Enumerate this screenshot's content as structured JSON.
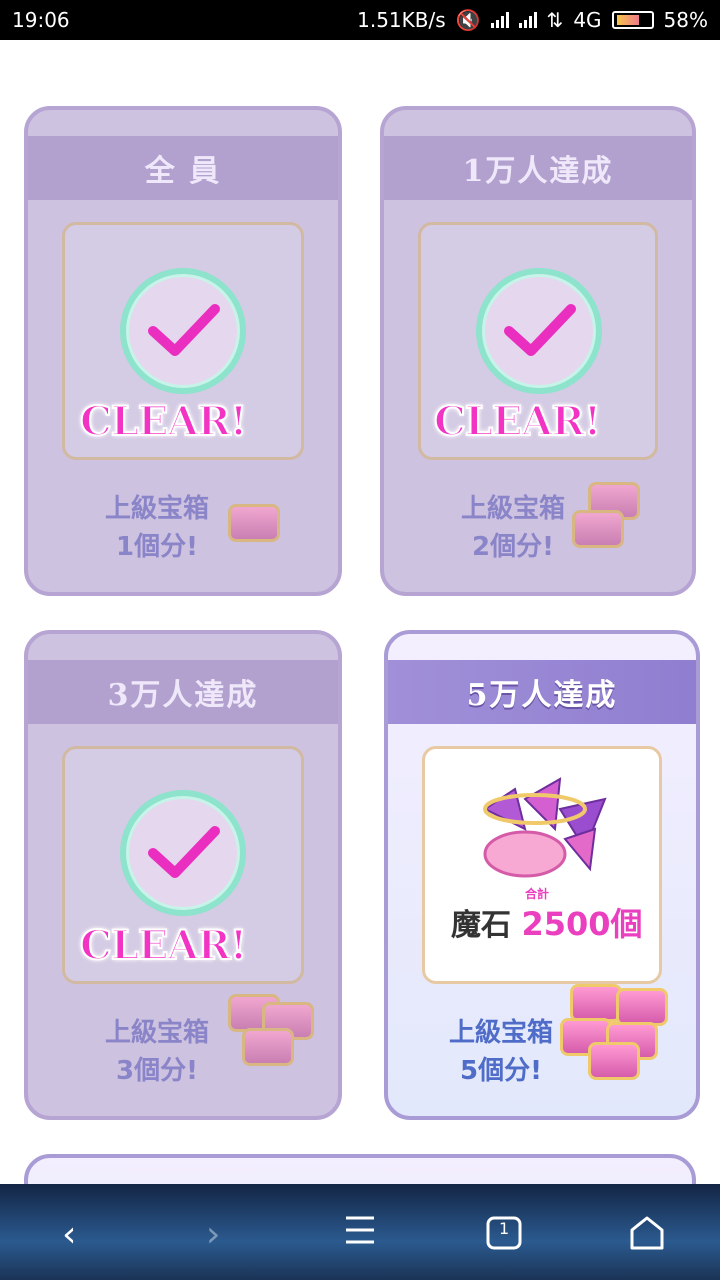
{
  "status_bar": {
    "time": "19:06",
    "net_speed": "1.51KB/s",
    "network": "4G",
    "battery": "58%"
  },
  "cards": [
    {
      "title": "全 員",
      "state": "clear",
      "reward_line1": "上級宝箱",
      "reward_line2": "1個分!",
      "overlay": "CLEAR!"
    },
    {
      "title": "1万人達成",
      "state": "clear",
      "reward_line1": "上級宝箱",
      "reward_line2": "2個分!",
      "overlay": "CLEAR!"
    },
    {
      "title": "3万人達成",
      "state": "clear",
      "reward_line1": "上級宝箱",
      "reward_line2": "3個分!",
      "overlay": "CLEAR!"
    },
    {
      "title": "5万人達成",
      "state": "active",
      "reward_line1": "上級宝箱",
      "reward_line2": "5個分!",
      "gem_label": "魔石",
      "gem_sub": "合計",
      "gem_amount": "2500個"
    }
  ],
  "colors": {
    "clear_text": "#f233c4",
    "check_ring": "#8de3cc",
    "card_done": "#cdc2e0"
  },
  "icons": [
    "back-icon",
    "forward-icon",
    "menu-icon",
    "tabs-icon",
    "home-icon"
  ],
  "nav": {
    "tabs_count": "1"
  }
}
